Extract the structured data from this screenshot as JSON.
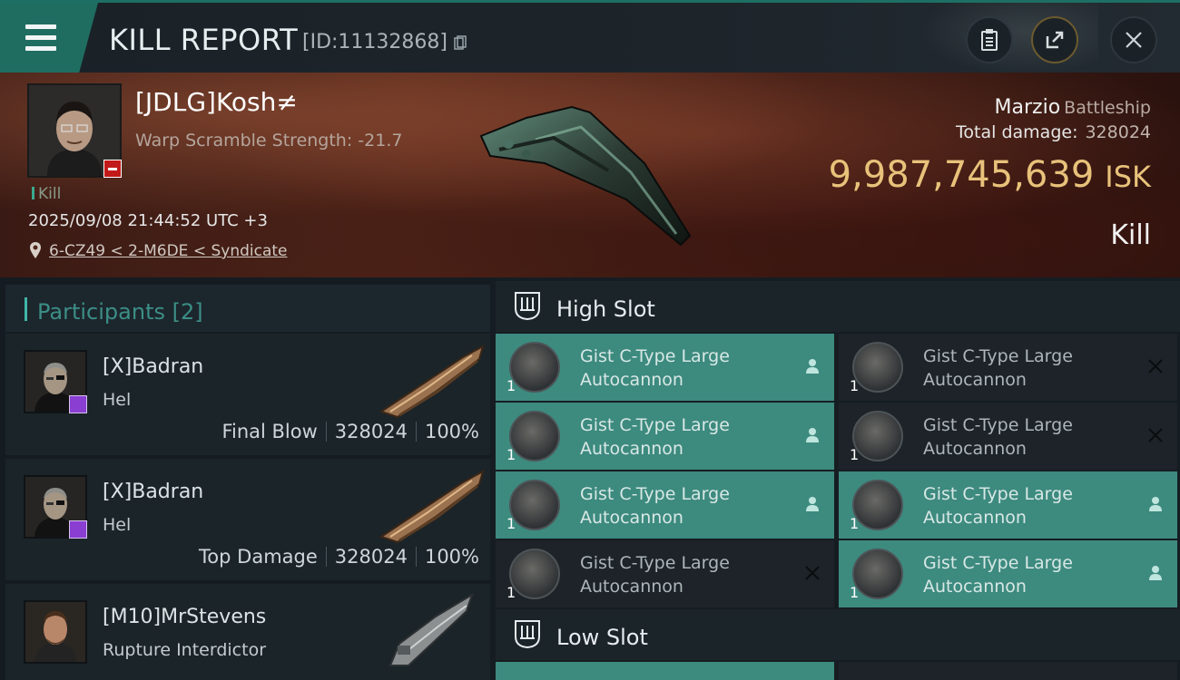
{
  "header": {
    "title": "KILL REPORT",
    "report_id": "[ID:11132868]",
    "icons": [
      "menu-icon",
      "copy-icon",
      "clipboard-icon",
      "share-icon",
      "close-icon"
    ]
  },
  "victim": {
    "name": "[JDLG]Kosh≠",
    "warp_scramble": "Warp Scramble Strength: -21.7",
    "tag": "Kill",
    "datetime": "2025/09/08 21:44:52 UTC +3",
    "location": "6-CZ49 < 2-M6DE < Syndicate",
    "ship_name": "Marzio",
    "ship_class": "Battleship",
    "total_damage_label": "Total damage:",
    "total_damage": "328024",
    "isk_value": "9,987,745,639",
    "isk_unit": "ISK",
    "result": "Kill"
  },
  "participants": {
    "title": "Participants [2]",
    "items": [
      {
        "name": "[X]Badran",
        "ship": "Hel",
        "role": "Final Blow",
        "damage": "328024",
        "percent": "100%"
      },
      {
        "name": "[X]Badran",
        "ship": "Hel",
        "role": "Top Damage",
        "damage": "328024",
        "percent": "100%"
      },
      {
        "name": "[M10]MrStevens",
        "ship": "Rupture Interdictor",
        "role": "",
        "damage": "",
        "percent": ""
      }
    ]
  },
  "slots": {
    "high_slot_title": "High Slot",
    "low_slot_title": "Low Slot",
    "high_modules": [
      {
        "name": "Gist C-Type Large Autocannon",
        "qty": "1",
        "status": "fitted"
      },
      {
        "name": "Gist C-Type Large Autocannon",
        "qty": "1",
        "status": "destroyed"
      },
      {
        "name": "Gist C-Type Large Autocannon",
        "qty": "1",
        "status": "fitted"
      },
      {
        "name": "Gist C-Type Large Autocannon",
        "qty": "1",
        "status": "destroyed"
      },
      {
        "name": "Gist C-Type Large Autocannon",
        "qty": "1",
        "status": "fitted"
      },
      {
        "name": "Gist C-Type Large Autocannon",
        "qty": "1",
        "status": "fitted"
      },
      {
        "name": "Gist C-Type Large Autocannon",
        "qty": "1",
        "status": "destroyed"
      },
      {
        "name": "Gist C-Type Large Autocannon",
        "qty": "1",
        "status": "fitted"
      }
    ]
  },
  "colors": {
    "accent": "#3fb6a7",
    "fitted_bg": "#3d8a7f",
    "isk": "#e8c27a",
    "danger": "#c21a1a",
    "corp_badge": "#8a3ed2"
  }
}
